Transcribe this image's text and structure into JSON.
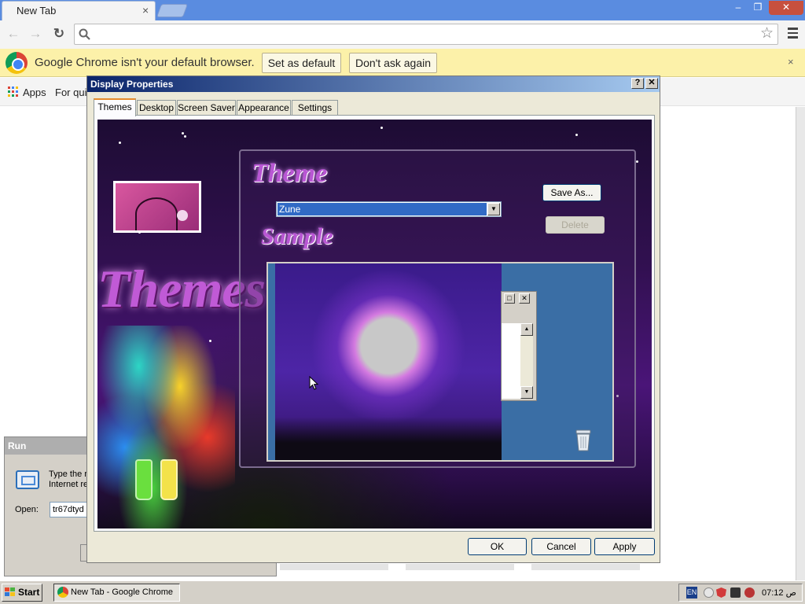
{
  "browser": {
    "tab_title": "New Tab",
    "tab_close": "×",
    "infobar": {
      "message": "Google Chrome isn't your default browser.",
      "set_default": "Set as default",
      "dont_ask": "Don't ask again",
      "close": "×"
    },
    "bookmarks": {
      "apps": "Apps",
      "for_quick": "For quic"
    },
    "window_controls": {
      "minimize": "–",
      "restore": "❐",
      "close": "✕"
    }
  },
  "run_dialog": {
    "title": "Run",
    "description_line1": "Type the n",
    "description_line2": "Internet re",
    "open_label": "Open:",
    "open_value": "tr67dtyd"
  },
  "display_properties": {
    "title": "Display Properties",
    "help_btn": "?",
    "close_btn": "✕",
    "tabs": [
      "Themes",
      "Desktop",
      "Screen Saver",
      "Appearance",
      "Settings"
    ],
    "theme_heading": "Theme",
    "theme_selected": "Zune",
    "save_as": "Save As...",
    "delete": "Delete",
    "sample_heading": "Sample",
    "art_word": "Themes",
    "ok": "OK",
    "cancel": "Cancel",
    "apply": "Apply"
  },
  "taskbar": {
    "start": "Start",
    "task_chrome": "New Tab - Google Chrome",
    "lang": "EN",
    "clock": "07:12 ص"
  },
  "colors": {
    "chrome_frame": "#5a8ce0",
    "infobar": "#fcf1a9",
    "dialog_title": "#0a246a",
    "theme_purple": "#b957d4"
  }
}
